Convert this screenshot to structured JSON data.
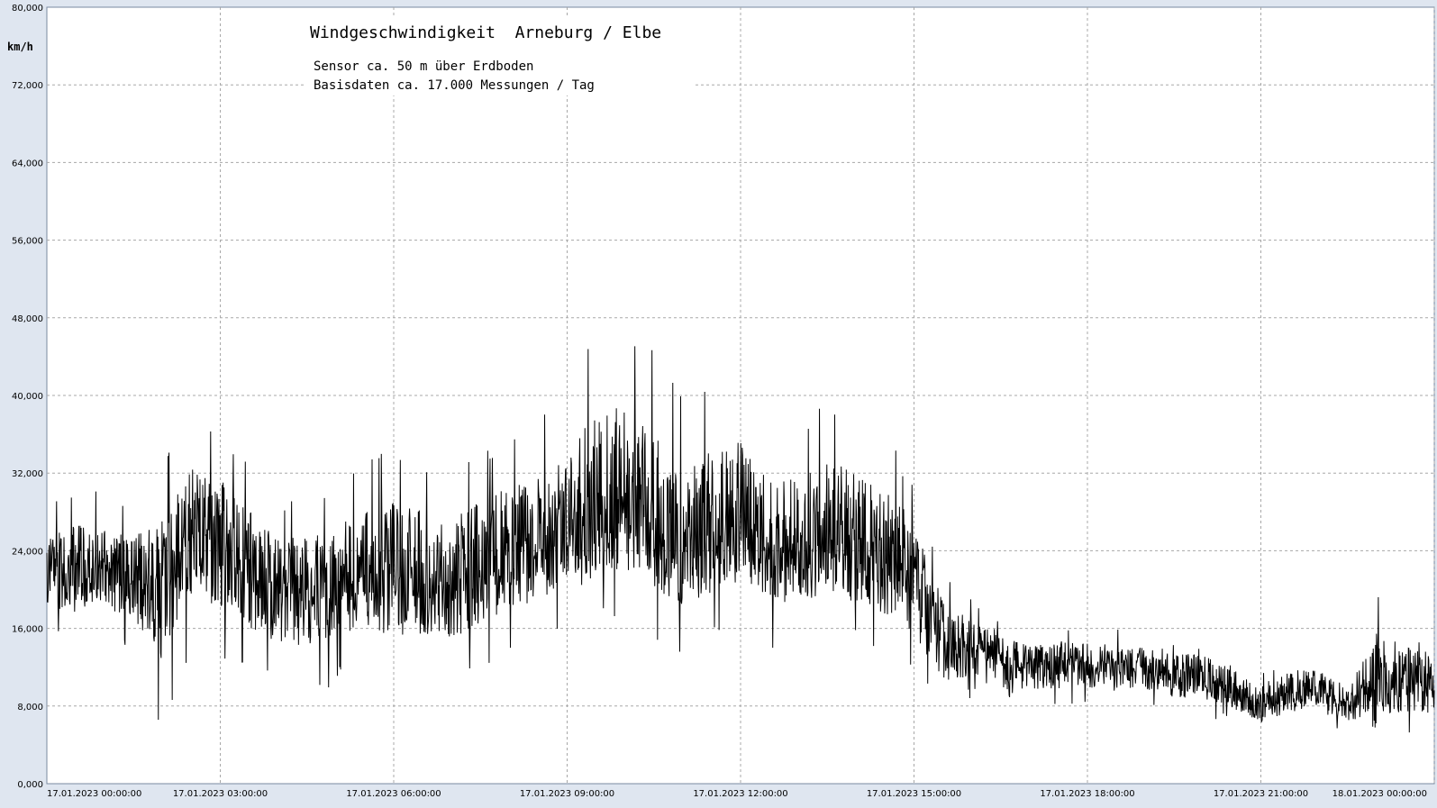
{
  "chart_data": {
    "type": "line",
    "title": "Windgeschwindigkeit  Arneburg / Elbe",
    "subtitle_lines": [
      "Sensor ca. 50 m über Erdboden",
      "Basisdaten ca. 17.000 Messungen / Tag"
    ],
    "ylabel": "km/h",
    "xlabel": "",
    "ylim": [
      0,
      80
    ],
    "y_ticks": [
      "0,000",
      "8,000",
      "16,000",
      "24,000",
      "32,000",
      "40,000",
      "48,000",
      "56,000",
      "64,000",
      "72,000",
      "80,000"
    ],
    "x_ticks": [
      {
        "date": "17.01.2023",
        "time": "00:00:00",
        "hour": 0
      },
      {
        "date": "17.01.2023",
        "time": "03:00:00",
        "hour": 3
      },
      {
        "date": "17.01.2023",
        "time": "06:00:00",
        "hour": 6
      },
      {
        "date": "17.01.2023",
        "time": "09:00:00",
        "hour": 9
      },
      {
        "date": "17.01.2023",
        "time": "12:00:00",
        "hour": 12
      },
      {
        "date": "17.01.2023",
        "time": "15:00:00",
        "hour": 15
      },
      {
        "date": "17.01.2023",
        "time": "18:00:00",
        "hour": 18
      },
      {
        "date": "17.01.2023",
        "time": "21:00:00",
        "hour": 21
      },
      {
        "date": "18.01.2023",
        "time": "00:00:00",
        "hour": 24
      }
    ],
    "x_unit": "hours since 17.01.2023 00:00:00",
    "grid": true,
    "line_color": "#000000",
    "series": [
      {
        "hours": [
          0,
          0.5,
          1,
          1.5,
          2,
          2.5,
          3,
          3.5,
          4,
          4.5,
          5,
          5.5,
          6,
          6.5,
          7,
          7.5,
          8,
          8.5,
          9,
          9.5,
          10,
          10.5,
          11,
          11.5,
          12,
          12.5,
          13,
          13.5,
          14,
          14.5,
          15,
          15.5,
          16,
          16.5,
          17,
          17.5,
          18,
          18.5,
          19,
          19.5,
          20,
          20.5,
          21,
          21.5,
          22,
          22.5,
          23,
          23.5,
          24
        ],
        "mean": [
          21,
          22,
          22,
          21,
          21,
          26,
          25,
          22,
          20,
          20,
          21,
          22,
          22,
          21,
          21,
          23,
          24,
          25,
          26,
          27,
          28,
          26,
          24,
          25,
          26,
          25,
          24,
          25,
          24,
          23,
          22,
          15,
          14,
          13,
          12,
          12,
          12,
          12,
          12,
          11,
          11,
          10,
          8,
          9,
          10,
          8,
          10,
          11,
          10
        ],
        "low": [
          15,
          14,
          15,
          13,
          5,
          14,
          12,
          11,
          10,
          9,
          10,
          12,
          9,
          11,
          10,
          11,
          13,
          14,
          15,
          16,
          17,
          15,
          13,
          15,
          16,
          14,
          14,
          15,
          14,
          13,
          10,
          7,
          8,
          7,
          8,
          8,
          8,
          8,
          8,
          7,
          7,
          6,
          5,
          6,
          6,
          5,
          5,
          4,
          5
        ],
        "high": [
          29,
          31,
          30,
          29,
          33,
          38,
          37,
          33,
          30,
          30,
          31,
          33,
          35,
          34,
          33,
          34,
          36,
          38,
          40,
          48,
          48,
          45,
          41,
          42,
          43,
          38,
          37,
          40,
          39,
          37,
          31,
          22,
          19,
          17,
          16,
          17,
          17,
          16,
          16,
          16,
          15,
          14,
          12,
          14,
          13,
          11,
          20,
          17,
          16
        ]
      }
    ]
  },
  "colors": {
    "background": "#dfe6f0",
    "plot_background": "#ffffff",
    "grid": "#a8a8a8",
    "axis": "#7a8aa0",
    "text": "#000000"
  }
}
